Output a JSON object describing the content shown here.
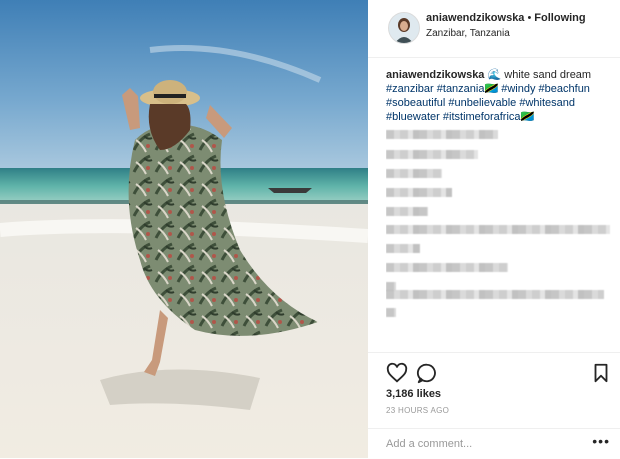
{
  "header": {
    "username": "aniawendzikowska",
    "separator": "•",
    "follow_status": "Following",
    "location": "Zanzibar, Tanzania"
  },
  "caption": {
    "username": "aniawendzikowska",
    "emoji": "🌊",
    "text": "white sand dream",
    "hashtags": [
      "#zanzibar",
      "#tanzania🇹🇿",
      "#windy",
      "#beachfun",
      "#sobeautiful",
      "#unbelievable",
      "#whitesand",
      "#bluewater",
      "#itstimeforafrica🇹🇿"
    ]
  },
  "actions": {
    "like_icon": "heart-icon",
    "comment_icon": "comment-icon",
    "save_icon": "bookmark-icon"
  },
  "likes": "3,186 likes",
  "timestamp": "23 HOURS AGO",
  "comment_box": {
    "placeholder": "Add a comment...",
    "more_icon": "more-options-icon",
    "more_label": "•••"
  },
  "colors": {
    "hashtag": "#003569",
    "text": "#262626",
    "muted": "#999999",
    "divider": "#efefef"
  }
}
